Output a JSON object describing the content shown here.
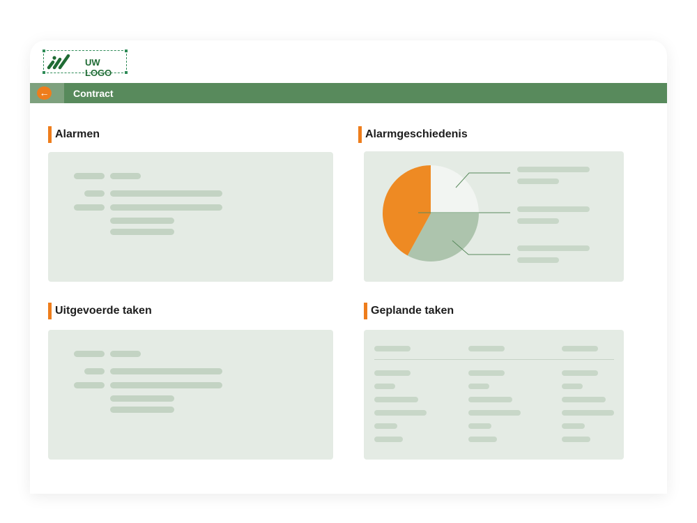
{
  "logo": {
    "text": "UW LOGO",
    "icon": "logo-stripes-icon",
    "color": "#1f6b34"
  },
  "topbar": {
    "title": "Contract",
    "back_icon": "arrow-left-icon",
    "color": "#588a5c",
    "accent": "#ee7d1c"
  },
  "sections": {
    "alarms": {
      "title": "Alarmen"
    },
    "alarm_history": {
      "title": "Alarmgeschiedenis"
    },
    "completed_tasks": {
      "title": "Uitgevoerde taken"
    },
    "planned_tasks": {
      "title": "Geplande taken"
    }
  },
  "chart_data": {
    "type": "pie",
    "title": "",
    "slices": [
      {
        "value": 25,
        "color": "#f2f5f2"
      },
      {
        "value": 33,
        "color": "#adc4ad"
      },
      {
        "value": 42,
        "color": "#ee8a23"
      }
    ]
  },
  "colors": {
    "accent": "#ee7d1c",
    "panel": "#e4ebe4",
    "placeholder": "#c3d3c3"
  }
}
